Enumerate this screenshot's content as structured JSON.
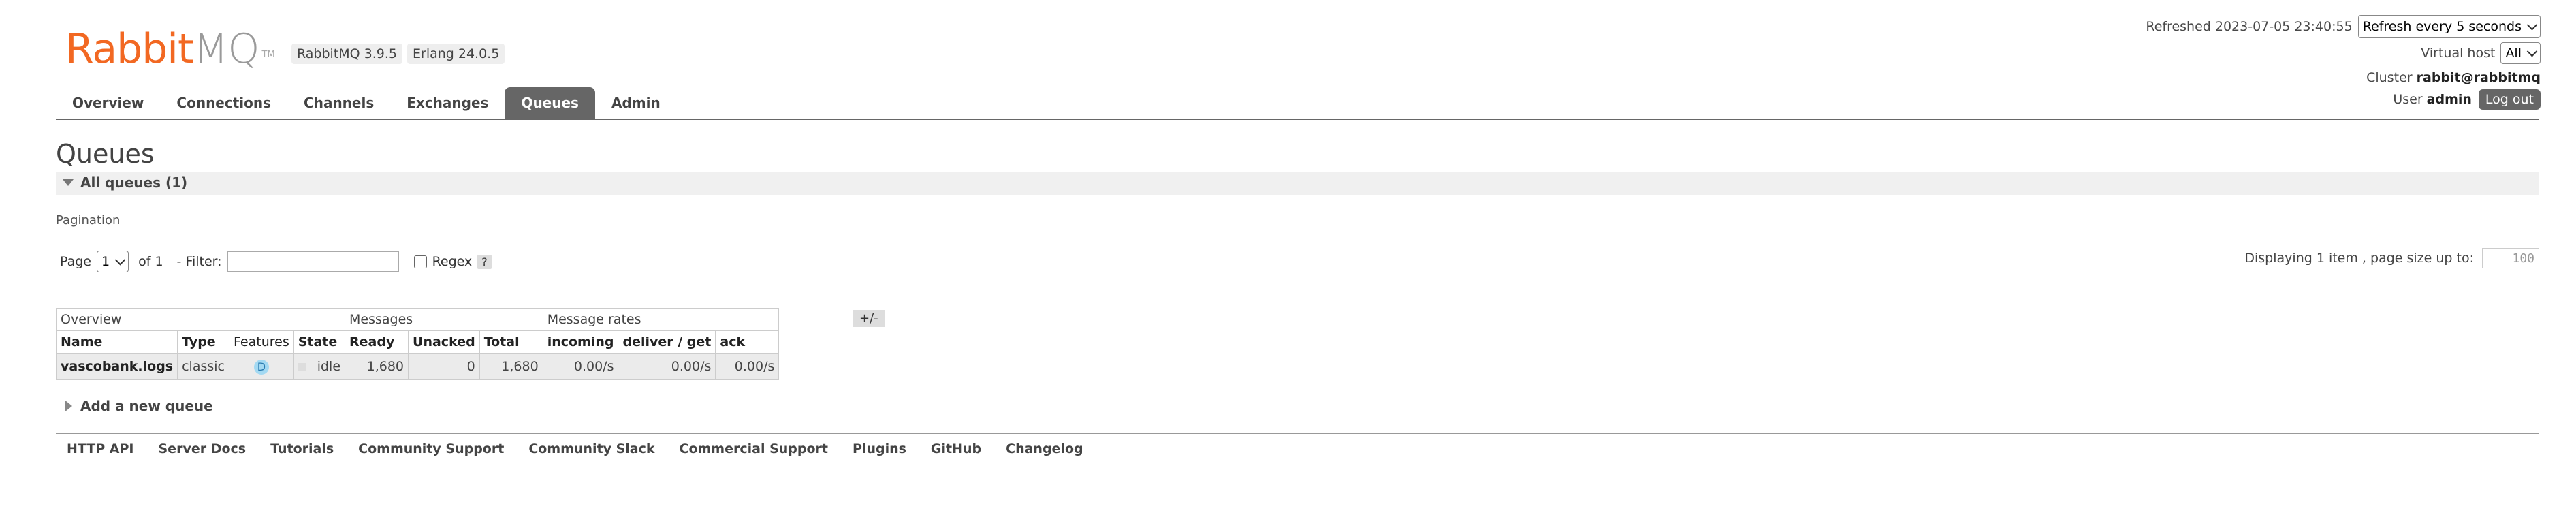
{
  "header": {
    "logo_brand": "Rabbit",
    "logo_product": "MQ",
    "logo_tm": "TM",
    "rabbitmq_version": "RabbitMQ 3.9.5",
    "erlang_version": "Erlang 24.0.5",
    "refreshed": "Refreshed 2023-07-05 23:40:55",
    "refresh_select": "Refresh every 5 seconds",
    "vhost_label": "Virtual host",
    "vhost_select": "All",
    "cluster_label": "Cluster",
    "cluster_name": "rabbit@rabbitmq",
    "user_label": "User",
    "user_name": "admin",
    "logout_label": "Log out",
    "brand_color": "#f26822"
  },
  "tabs": [
    {
      "label": "Overview",
      "active": false
    },
    {
      "label": "Connections",
      "active": false
    },
    {
      "label": "Channels",
      "active": false
    },
    {
      "label": "Exchanges",
      "active": false
    },
    {
      "label": "Queues",
      "active": true
    },
    {
      "label": "Admin",
      "active": false
    }
  ],
  "page": {
    "title": "Queues",
    "section_title": "All queues (1)",
    "pagination_label": "Pagination",
    "page_label": "Page",
    "page_value": "1",
    "of_label": "of 1",
    "filter_label": "- Filter:",
    "filter_value": "",
    "regex_label": "Regex",
    "help_label": "?",
    "display_text": "Displaying 1 item , page size up to:",
    "page_size_placeholder": "100"
  },
  "table": {
    "groups": [
      "Overview",
      "Messages",
      "Message rates"
    ],
    "plus_minus": "+/-",
    "headers": [
      "Name",
      "Type",
      "Features",
      "State",
      "Ready",
      "Unacked",
      "Total",
      "incoming",
      "deliver / get",
      "ack"
    ],
    "rows": [
      {
        "name": "vascobank.logs",
        "type": "classic",
        "features": "D",
        "state": "idle",
        "ready": "1,680",
        "unacked": "0",
        "total": "1,680",
        "incoming": "0.00/s",
        "deliver_get": "0.00/s",
        "ack": "0.00/s"
      }
    ]
  },
  "add_queue_label": "Add a new queue",
  "footer": [
    "HTTP API",
    "Server Docs",
    "Tutorials",
    "Community Support",
    "Community Slack",
    "Commercial Support",
    "Plugins",
    "GitHub",
    "Changelog"
  ]
}
